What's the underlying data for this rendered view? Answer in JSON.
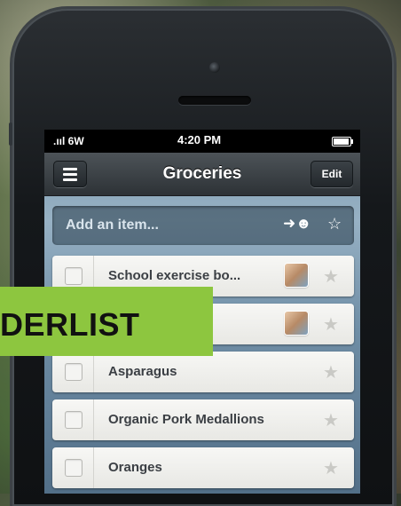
{
  "status_bar": {
    "signal": ".ııl 6W",
    "time": "4:20 PM"
  },
  "navbar": {
    "title": "Groceries",
    "edit_label": "Edit"
  },
  "add_item": {
    "placeholder": "Add an item..."
  },
  "items": [
    {
      "label": "School exercise bo...",
      "assigned": true,
      "starred": false
    },
    {
      "label": "",
      "assigned": true,
      "starred": false
    },
    {
      "label": "Asparagus",
      "assigned": false,
      "starred": false
    },
    {
      "label": "Organic Pork Medallions",
      "assigned": false,
      "starred": false
    },
    {
      "label": "Oranges",
      "assigned": false,
      "starred": false
    }
  ],
  "overlay_banner": {
    "text": "DERLIST",
    "color": "#8dc63f"
  },
  "icons": {
    "menu": "hamburger-icon",
    "assign": "person-icon",
    "star": "star-icon",
    "battery": "battery-icon"
  }
}
